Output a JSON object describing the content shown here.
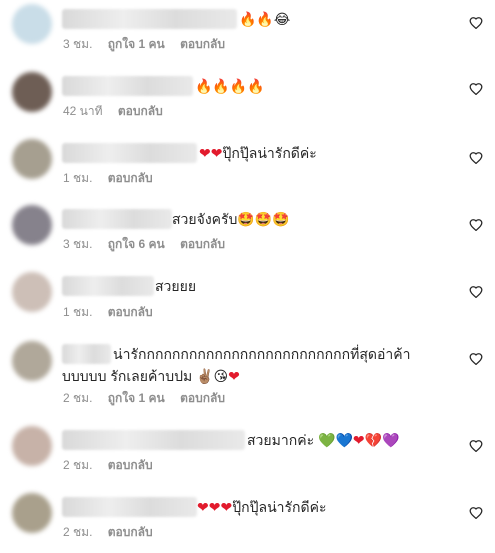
{
  "comments": [
    {
      "text": "🔥🔥😂",
      "time": "3 ชม.",
      "likes": "ถูกใจ 1 คน",
      "reply": "ตอบกลับ"
    },
    {
      "text": "🔥🔥🔥🔥",
      "time": "42 นาที",
      "likes": "",
      "reply": "ตอบกลับ"
    },
    {
      "text": "❤❤ปุ๊กปุ๊ลน่ารักดีค่ะ",
      "time": "1 ชม.",
      "likes": "",
      "reply": "ตอบกลับ"
    },
    {
      "text": "สวยจังครับ🤩🤩🤩",
      "time": "3 ชม.",
      "likes": "ถูกใจ 6 คน",
      "reply": "ตอบกลับ"
    },
    {
      "text": "สวยยย",
      "time": "1 ชม.",
      "likes": "",
      "reply": "ตอบกลับ"
    },
    {
      "text": "น่ารักกกกกกกกกกกกกกกกกกกกกกกกกที่สุดอ่าค้าบบบบบ รักเลยค้าบปม ✌🏽😘❤",
      "time": "2 ชม.",
      "likes": "ถูกใจ 1 คน",
      "reply": "ตอบกลับ"
    },
    {
      "text": "สวยมากค่ะ 💚💙❤💔💜",
      "time": "2 ชม.",
      "likes": "",
      "reply": "ตอบกลับ"
    },
    {
      "text": "❤❤❤ปุ๊กปุ๊ลน่ารักดีค่ะ",
      "time": "2 ชม.",
      "likes": "",
      "reply": "ตอบกลับ"
    }
  ],
  "colors": {
    "text": "#262626",
    "meta": "#8e8e8e",
    "heart_outline": "#262626"
  }
}
